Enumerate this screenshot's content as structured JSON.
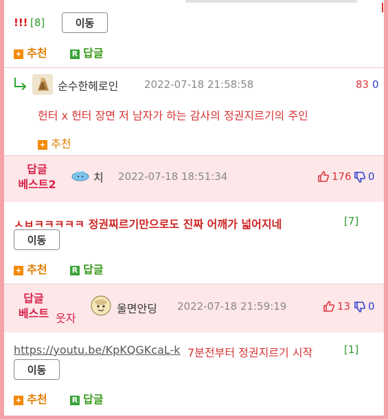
{
  "top_comment": {
    "exclaim": "!!!",
    "count": "[8]",
    "move_label": "이동",
    "recommend_label": "추천",
    "reply_label": "답글"
  },
  "reply": {
    "nickname": "순수한헤로인",
    "datetime": "2022-07-18 21:58:58",
    "up_count": "83",
    "down_count": "0",
    "content": "헌터 x 헌터 장면 저 남자가 하는 감사의 정권지르기의 주인",
    "recommend_label": "추천"
  },
  "best2": {
    "label_line1": "답글",
    "label_line2": "베스트2",
    "nickname": "치",
    "datetime": "2022-07-18 18:51:34",
    "up_count": "176",
    "down_count": "0",
    "content": "ㅅㅂㅋㅋㅋㅋㅋ 정권찌르기만으로도 진짜 어깨가 넓어지네",
    "count": "[7]",
    "move_label": "이동",
    "recommend_label": "추천",
    "reply_label": "답글"
  },
  "best": {
    "label_line1": "답글",
    "label_line2": "베스트",
    "sub_label": "웃자",
    "nickname": "울면안딩",
    "datetime": "2022-07-18 21:59:19",
    "up_count": "13",
    "down_count": "0",
    "link": "https://youtu.be/KpKQGKcaL-k",
    "content": "7분전부터 정권지르기 시작",
    "count": "[1]",
    "move_label": "이동",
    "recommend_label": "추천",
    "reply_label": "답글"
  },
  "colors": {
    "frame": "#f5a3a8",
    "best_band": "#fde7e8",
    "accent_red": "#d8214a",
    "recommend_orange": "#f28a00",
    "reply_green": "#3ba33b",
    "down_blue": "#2d3ccf"
  },
  "icons": [
    "plus-square-icon",
    "reply-square-icon",
    "reply-arrow-icon",
    "thumbs-up-icon",
    "thumbs-down-icon"
  ]
}
